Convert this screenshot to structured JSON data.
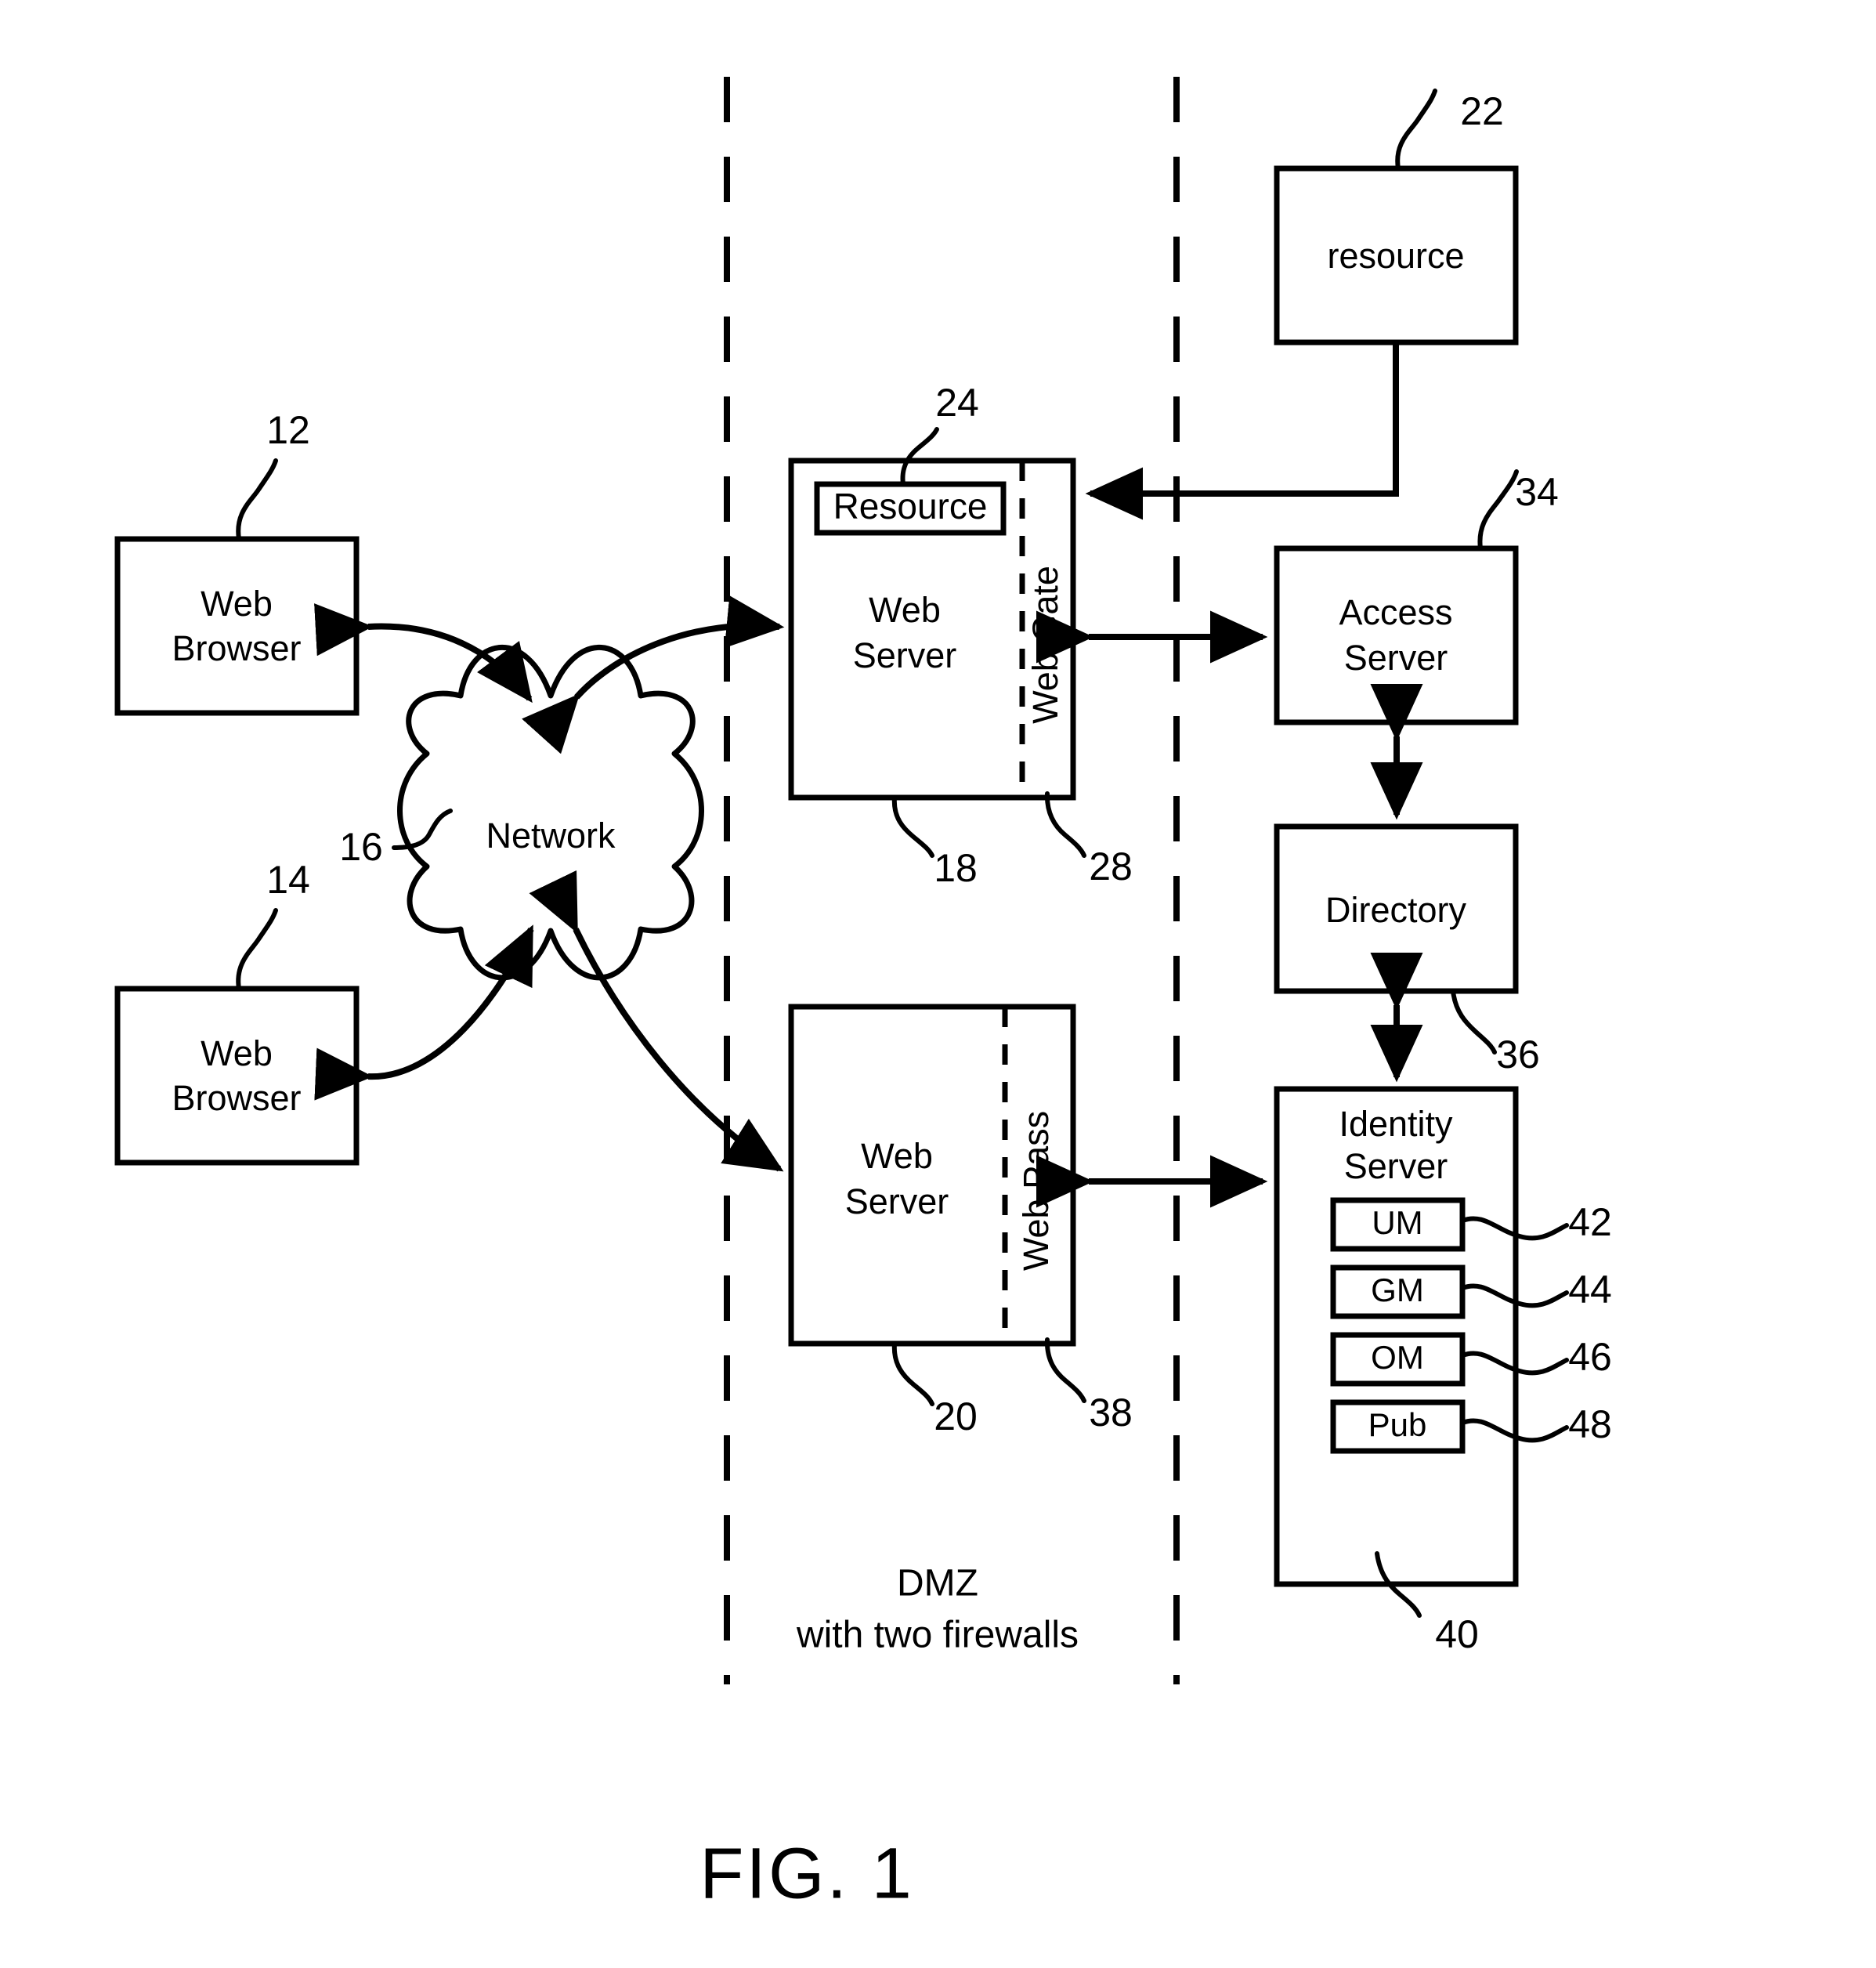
{
  "figure": {
    "title": "FIG. 1",
    "zone_note_line1": "DMZ",
    "zone_note_line2": "with  two firewalls"
  },
  "nodes": {
    "web_browser_top": {
      "label_line1": "Web",
      "label_line2": "Browser",
      "ref": "12"
    },
    "web_browser_bottom": {
      "label_line1": "Web",
      "label_line2": "Browser",
      "ref": "14"
    },
    "network": {
      "label": "Network",
      "ref": "16"
    },
    "web_server_top": {
      "label_line1": "Web",
      "label_line2": "Server",
      "ref": "18"
    },
    "web_gate": {
      "label": "Web Gate",
      "ref": "28"
    },
    "resource_inner": {
      "label": "Resource",
      "ref": "24"
    },
    "web_server_bottom": {
      "label_line1": "Web",
      "label_line2": "Server",
      "ref": "20"
    },
    "web_pass": {
      "label": "Web Pass",
      "ref": "38"
    },
    "resource_external": {
      "label": "resource",
      "ref": "22"
    },
    "access_server": {
      "label_line1": "Access",
      "label_line2": "Server",
      "ref": "34"
    },
    "directory": {
      "label": "Directory",
      "ref": "36"
    },
    "identity_server": {
      "label_line1": "Identity",
      "label_line2": "Server",
      "ref": "40"
    },
    "um": {
      "label": "UM",
      "ref": "42"
    },
    "gm": {
      "label": "GM",
      "ref": "44"
    },
    "om": {
      "label": "OM",
      "ref": "46"
    },
    "pub": {
      "label": "Pub",
      "ref": "48"
    }
  },
  "colors": {
    "stroke": "#000000",
    "fill": "#ffffff",
    "background": "#ffffff"
  }
}
